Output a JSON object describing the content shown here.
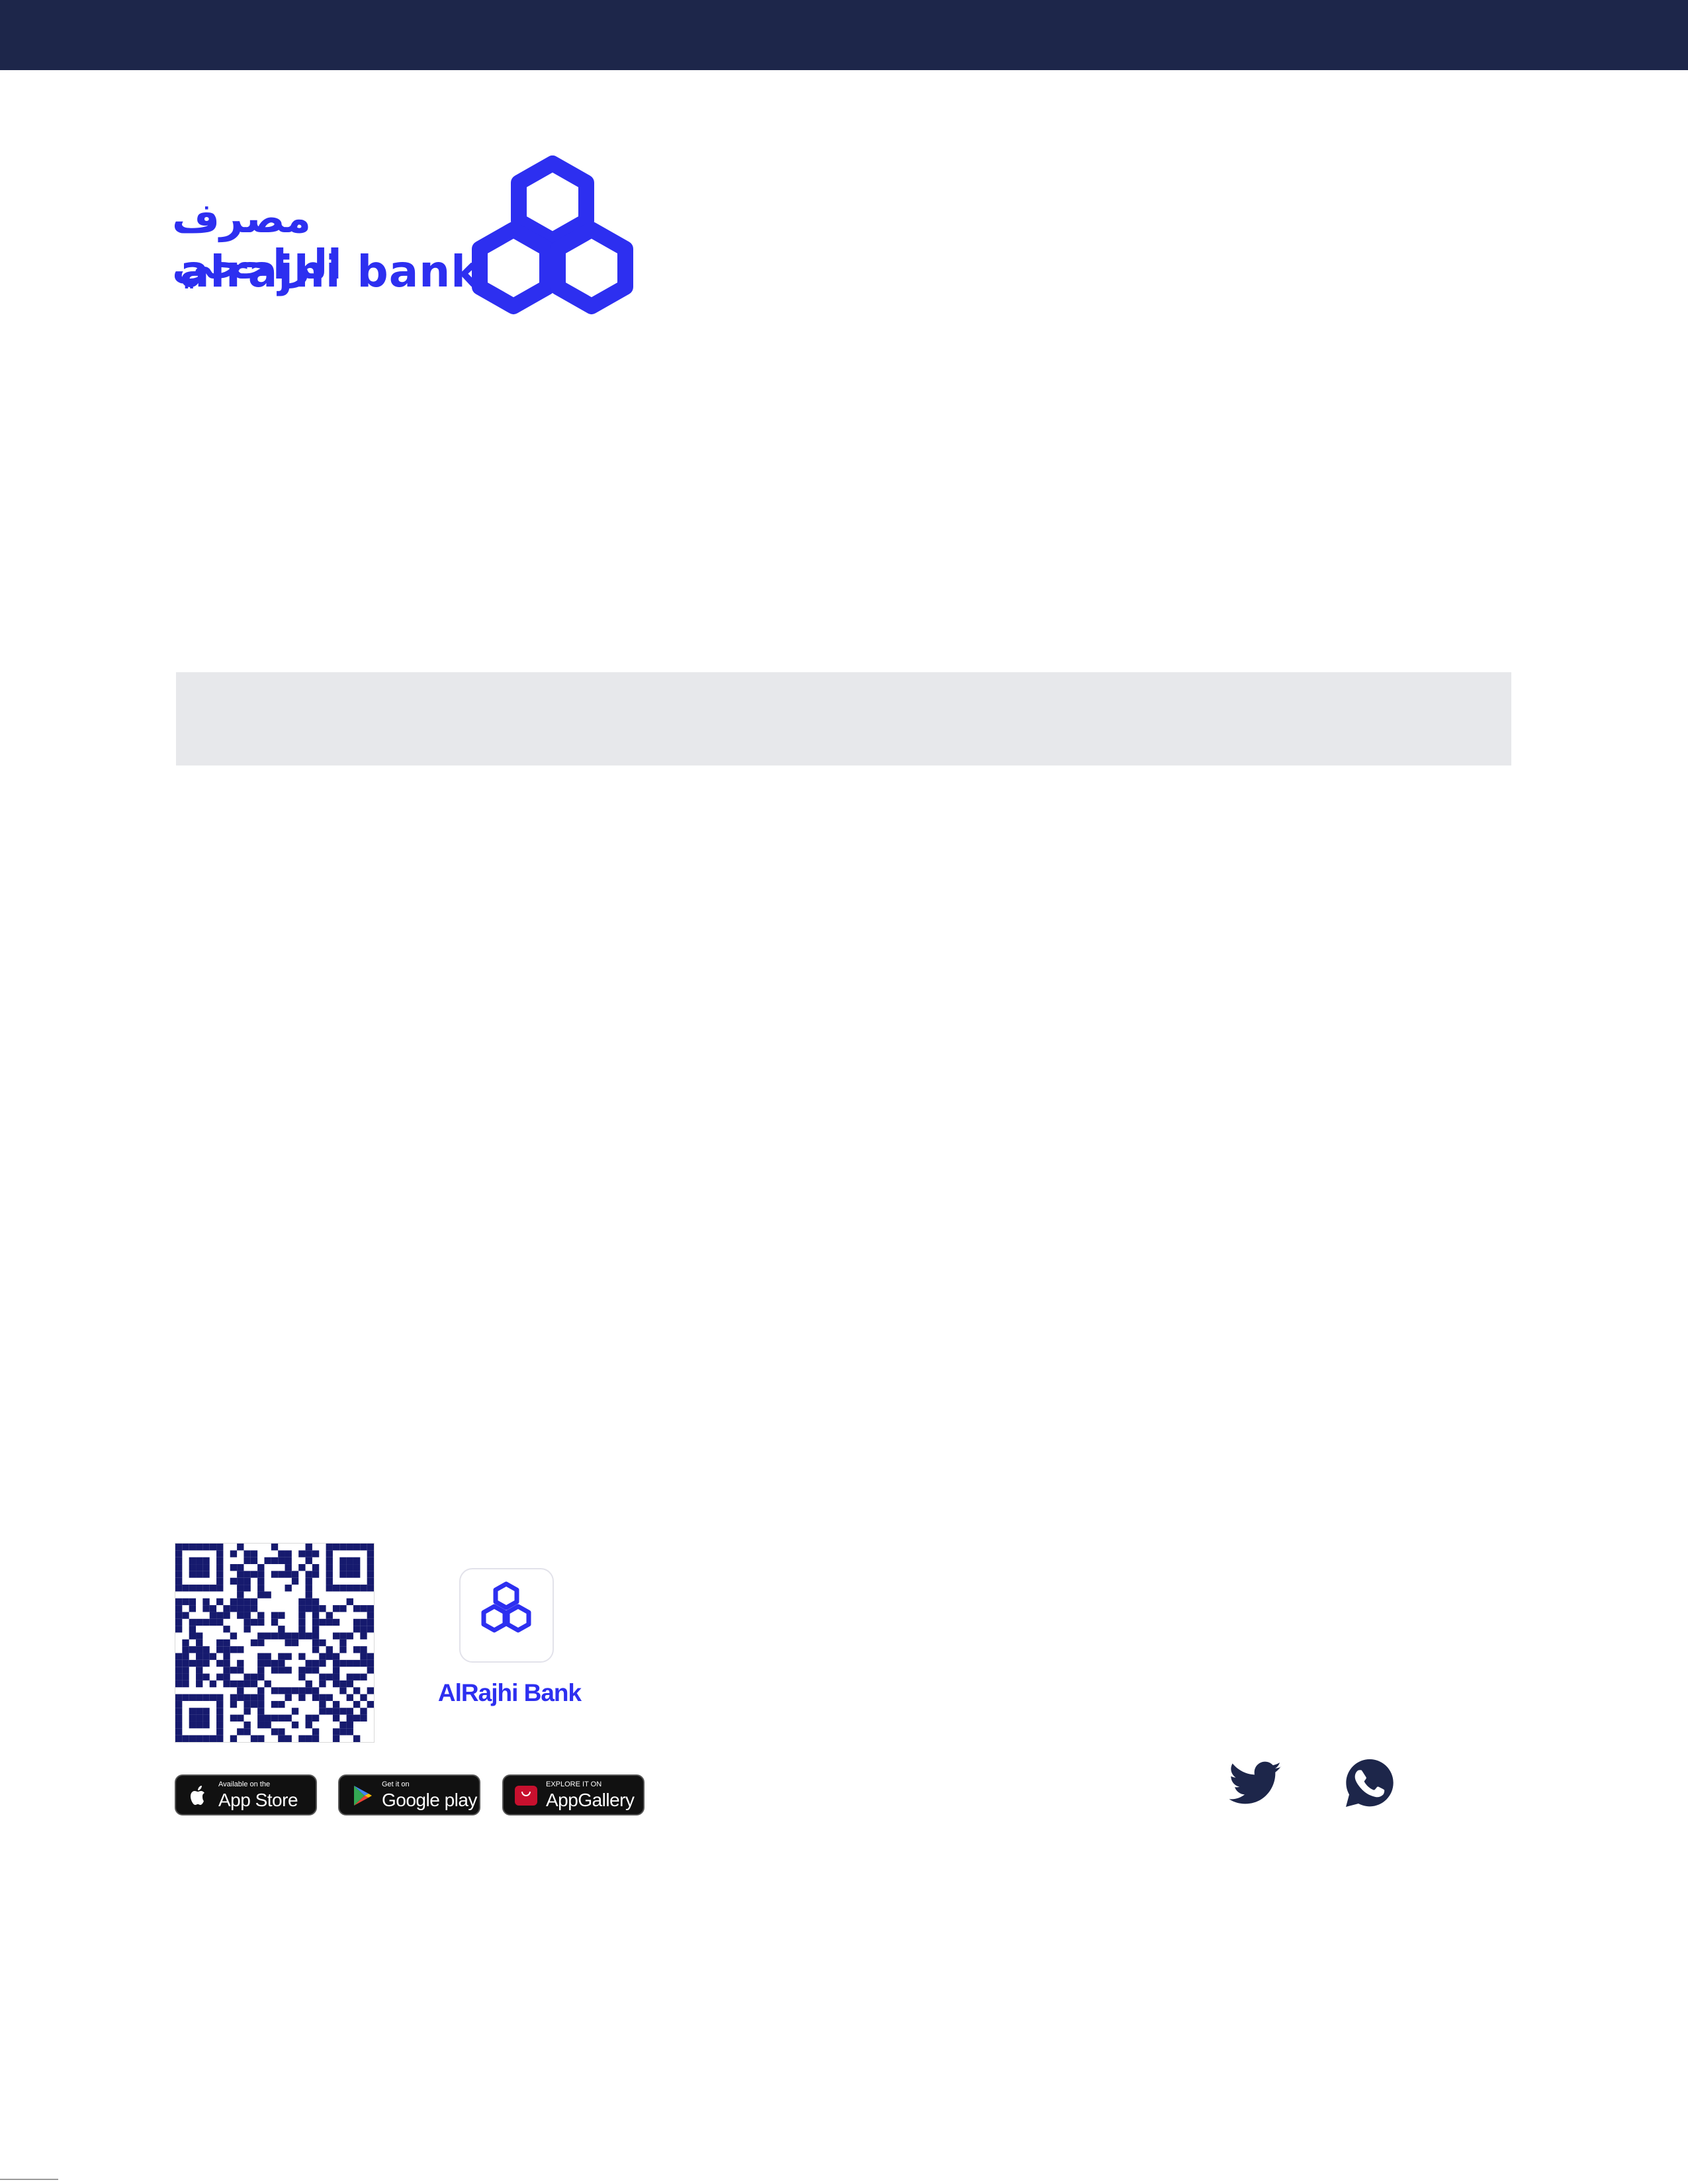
{
  "brand": {
    "arabic_name": "مصرف الراجحي",
    "latin_name": "alrajhi bank",
    "color": "#2d2ff0"
  },
  "header": {
    "bar_color": "#1d264a"
  },
  "app_promo": {
    "qr_icon": "qr-code",
    "app_icon": "alrajhi-app-icon",
    "app_name": "AlRajhi Bank"
  },
  "store_badges": [
    {
      "icon": "apple-icon",
      "small": "Available on the",
      "big": "App Store"
    },
    {
      "icon": "google-play-icon",
      "small": "Get it on",
      "big": "Google play"
    },
    {
      "icon": "huawei-icon",
      "small": "EXPLORE IT ON",
      "big": "AppGallery"
    }
  ],
  "social": [
    {
      "icon": "twitter-icon"
    },
    {
      "icon": "whatsapp-icon"
    }
  ]
}
